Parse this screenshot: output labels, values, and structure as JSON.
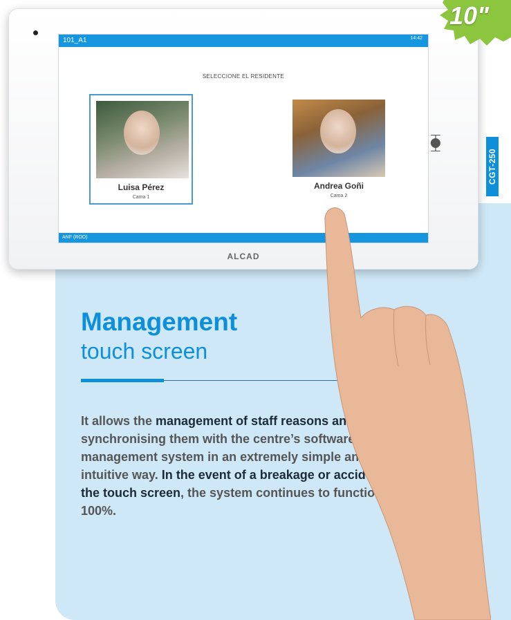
{
  "badges": {
    "size": "10\"",
    "model": "CGT-250"
  },
  "device": {
    "brand": "ALCAD",
    "screen": {
      "location": "101_A1",
      "time": "14:42",
      "title": "SELECCIONE EL RESIDENTE",
      "footer": "ANF (ROO)",
      "residents": [
        {
          "name": "Luisa Pérez",
          "bed": "Cama 1",
          "selected": true
        },
        {
          "name": "Andrea Goñi",
          "bed": "Cama 2",
          "selected": false
        }
      ]
    }
  },
  "content": {
    "heading_line1": "Management",
    "heading_line2": "touch screen",
    "body_intro": "It allows the ",
    "body_em1": "management of staff reasons and actions",
    "body_mid": ", synchronising them with the centre’s software management system in an extremely simple and intuitive way. ",
    "body_em2": "In the event of a breakage or accident with the touch screen",
    "body_end": ", the system continues to function at 100%."
  },
  "colors": {
    "accent": "#0d8fd9",
    "panel": "#cfe8f7",
    "screen_bar": "#1596de"
  }
}
